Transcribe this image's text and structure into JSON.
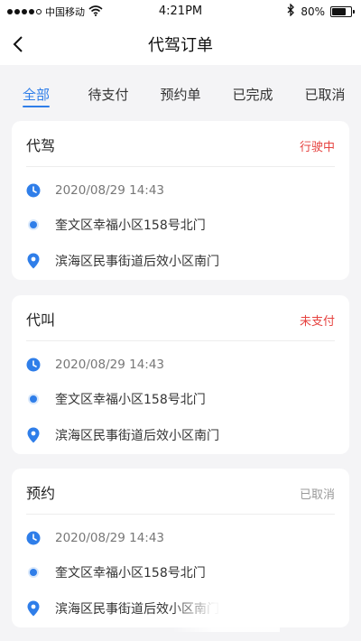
{
  "status_bar": {
    "carrier": "中国移动",
    "time": "4:21PM",
    "battery_text": "80%",
    "battery_level": 0.8
  },
  "nav": {
    "title": "代驾订单"
  },
  "tabs": [
    {
      "label": "全部",
      "active": true
    },
    {
      "label": "待支付",
      "active": false
    },
    {
      "label": "预约单",
      "active": false
    },
    {
      "label": "已完成",
      "active": false
    },
    {
      "label": "已取消",
      "active": false
    }
  ],
  "orders": [
    {
      "type": "代驾",
      "status": "行驶中",
      "status_color": "#e64340",
      "time": "2020/08/29  14:43",
      "origin": "奎文区幸福小区158号北门",
      "destination": "滨海区民事街道后效小区南门"
    },
    {
      "type": "代叫",
      "status": "未支付",
      "status_color": "#e64340",
      "time": "2020/08/29  14:43",
      "origin": "奎文区幸福小区158号北门",
      "destination": "滨海区民事街道后效小区南门"
    },
    {
      "type": "预约",
      "status": "已取消",
      "status_color": "#999999",
      "time": "2020/08/29  14:43",
      "origin": "奎文区幸福小区158号北门",
      "destination": "滨海区民事街道后效小区南门"
    }
  ],
  "icons": {
    "time": "clock-icon",
    "origin": "origin-dot-icon",
    "destination": "location-pin-icon"
  },
  "colors": {
    "accent": "#2f7ee9",
    "alert": "#e64340",
    "muted": "#999999"
  }
}
